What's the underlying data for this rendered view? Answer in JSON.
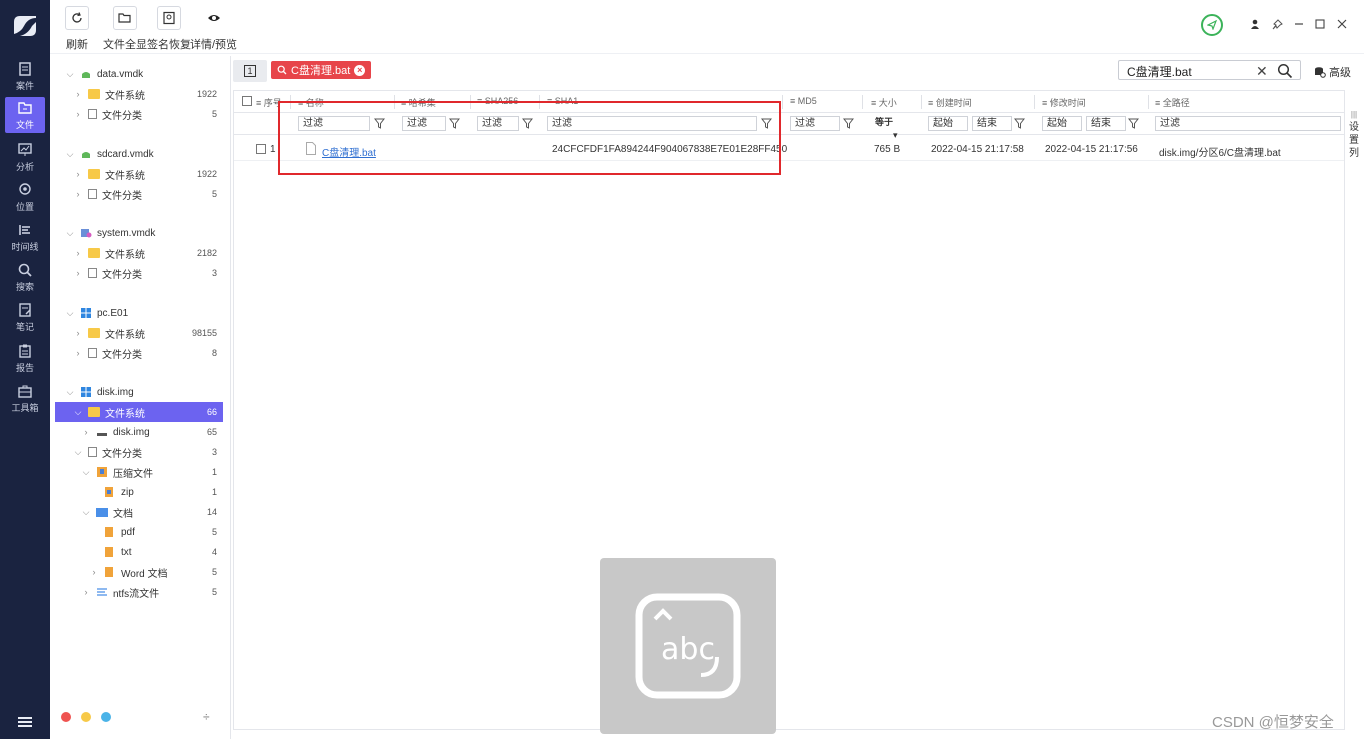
{
  "nav": {
    "items": [
      {
        "label": "案件",
        "icon": "case-icon"
      },
      {
        "label": "文件",
        "icon": "file-icon"
      },
      {
        "label": "分析",
        "icon": "analysis-icon"
      },
      {
        "label": "位置",
        "icon": "location-icon"
      },
      {
        "label": "时间线",
        "icon": "timeline-icon"
      },
      {
        "label": "搜索",
        "icon": "search-icon"
      },
      {
        "label": "笔记",
        "icon": "note-icon"
      },
      {
        "label": "报告",
        "icon": "report-icon"
      },
      {
        "label": "工具箱",
        "icon": "toolbox-icon"
      }
    ],
    "active_index": 1
  },
  "toolbar": {
    "refresh": "刷新",
    "show_all": "文件全显",
    "signature_recover": "签名恢复",
    "detail_preview": "详情/预览"
  },
  "tree": {
    "sources": [
      {
        "name": "data.vmdk",
        "fs_label": "文件系统",
        "fs_count": "1922",
        "cat_label": "文件分类",
        "cat_count": "5"
      },
      {
        "name": "sdcard.vmdk",
        "fs_label": "文件系统",
        "fs_count": "1922",
        "cat_label": "文件分类",
        "cat_count": "5"
      },
      {
        "name": "system.vmdk",
        "fs_label": "文件系统",
        "fs_count": "2182",
        "cat_label": "文件分类",
        "cat_count": "3"
      },
      {
        "name": "pc.E01",
        "fs_label": "文件系统",
        "fs_count": "98155",
        "cat_label": "文件分类",
        "cat_count": "8"
      }
    ],
    "disk": {
      "name": "disk.img",
      "fs_label": "文件系统",
      "fs_count": "66",
      "img_label": "disk.img",
      "img_count": "65",
      "cat_label": "文件分类",
      "cat_count": "3",
      "zip_group": "压缩文件",
      "zip_group_count": "1",
      "zip": "zip",
      "zip_count": "1",
      "docs": "文档",
      "docs_count": "14",
      "pdf": "pdf",
      "pdf_count": "5",
      "txt": "txt",
      "txt_count": "4",
      "word": "Word 文档",
      "word_count": "5",
      "ntfs": "ntfs流文件",
      "ntfs_count": "5"
    }
  },
  "tabs": {
    "number": "1",
    "search_tab": "C盘清理.bat"
  },
  "search": {
    "value": "C盘清理.bat",
    "advanced": "高级"
  },
  "table": {
    "headers": [
      "序号",
      "名称",
      "哈希集",
      "SHA256",
      "SHA1",
      "MD5",
      "大小",
      "创建时间",
      "修改时间",
      "全路径"
    ],
    "filter_text": "过滤",
    "size_op": "等于",
    "start": "起始",
    "end": "结束",
    "settings": [
      "设",
      "置",
      "列"
    ],
    "rows": [
      {
        "index": "1",
        "name": "C盘清理.bat",
        "sha1": "24CFCFDF1FA894244F904067838E7E01E28FF450",
        "size": "765 B",
        "created": "2022-04-15 21:17:58",
        "modified": "2022-04-15 21:17:56",
        "path": "disk.img/分区6/C盘清理.bat"
      }
    ]
  },
  "watermark": "CSDN @恒梦安全",
  "colors": {
    "nav_bg": "#1a2340",
    "accent": "#6c63f0",
    "search_tab": "#e7454a",
    "highlight_box": "#e0282c",
    "status_ok": "#3cb35a"
  }
}
